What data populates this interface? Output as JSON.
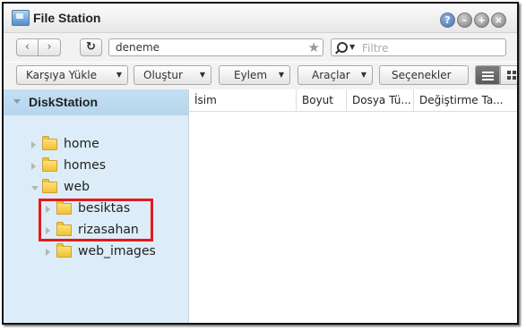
{
  "window": {
    "title": "File Station"
  },
  "nav": {
    "path": "deneme",
    "filter_placeholder": "Filtre"
  },
  "toolbar": {
    "upload_label": "Karşıya Yükle",
    "create_label": "Oluştur",
    "action_label": "Eylem",
    "tools_label": "Araçlar",
    "settings_label": "Seçenekler"
  },
  "sidebar": {
    "root": "DiskStation",
    "items": [
      {
        "label": "home"
      },
      {
        "label": "homes"
      },
      {
        "label": "web"
      },
      {
        "label": "besiktas"
      },
      {
        "label": "rizasahan"
      },
      {
        "label": "web_images"
      }
    ]
  },
  "columns": [
    "İsim",
    "Boyut",
    "Dosya Tü...",
    "Değiştirme Ta..."
  ],
  "colors": {
    "highlight": "#e21b1b",
    "sidebar_bg": "#dcecf8",
    "sidebar_header": "#b5d6ee"
  },
  "icons": [
    "app-icon",
    "help-icon",
    "minimize-icon",
    "maximize-icon",
    "close-icon",
    "back-icon",
    "forward-icon",
    "refresh-icon",
    "star-icon",
    "search-icon",
    "list-view-icon",
    "grid-view-icon",
    "folder-icon"
  ]
}
